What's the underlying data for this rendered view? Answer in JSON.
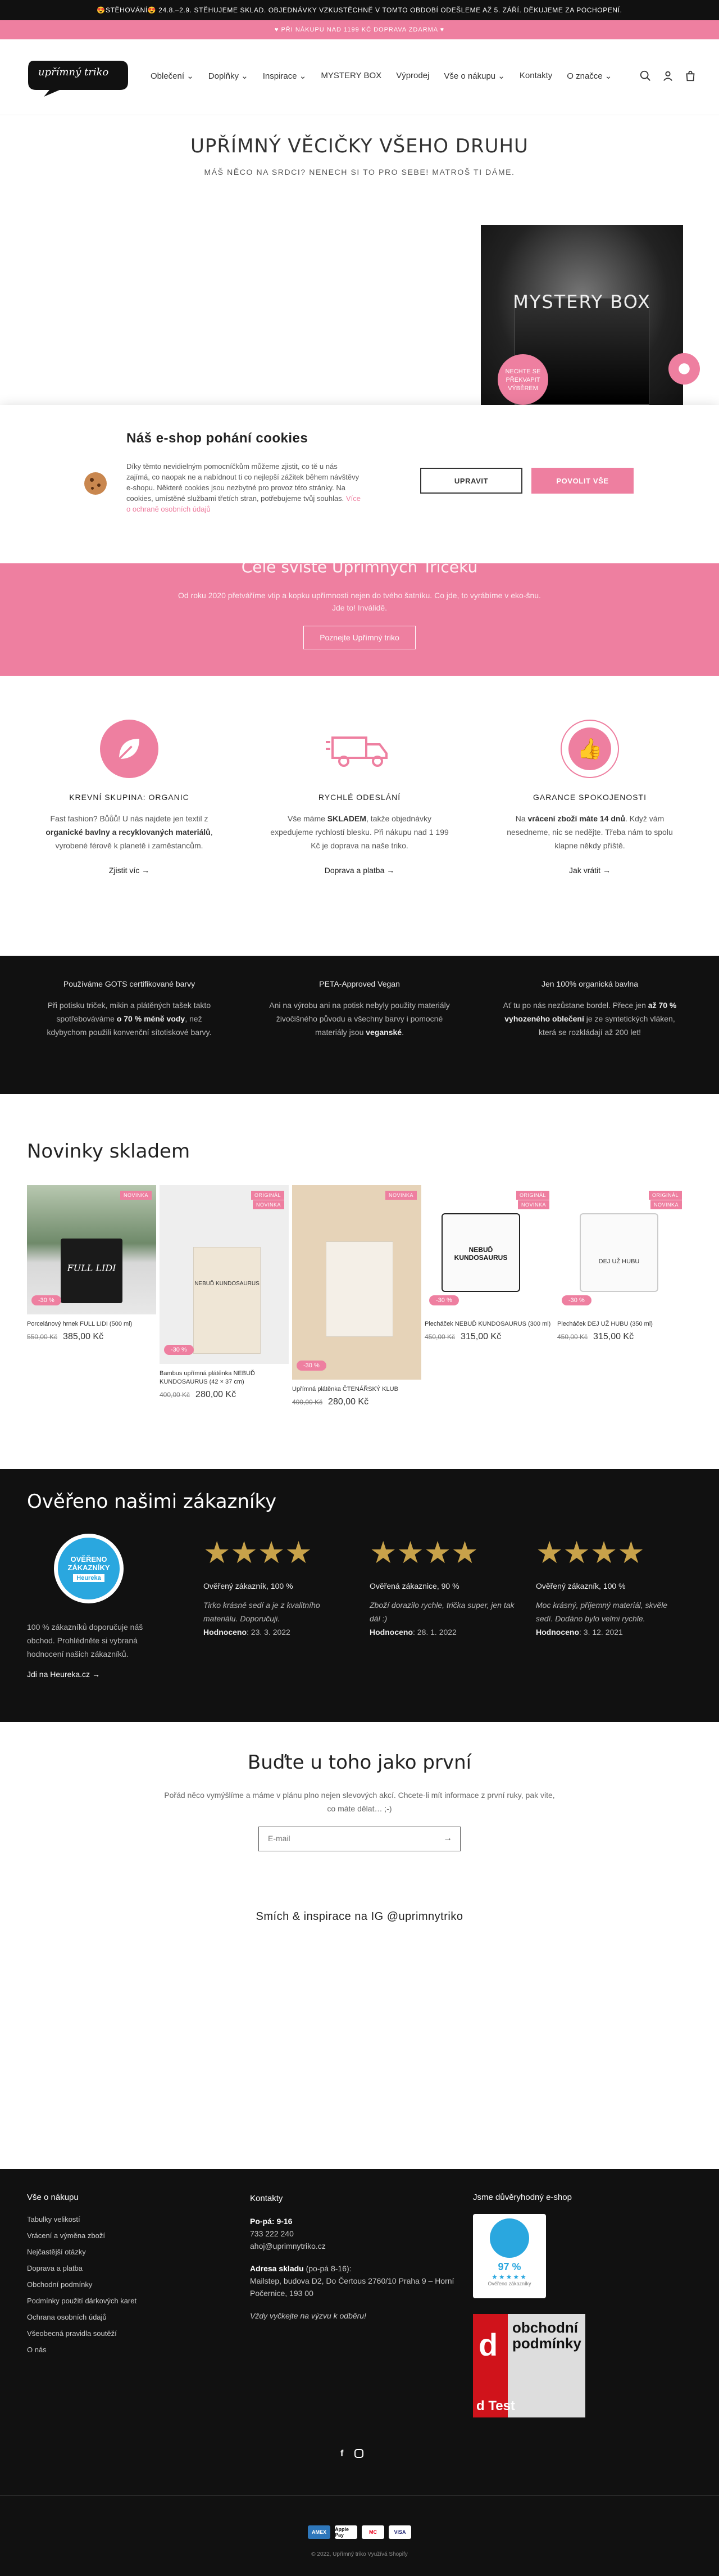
{
  "announcement": {
    "top": "😍STĚHOVÁNÍ😍 24.8.–2.9. STĚHUJEME SKLAD. OBJEDNÁVKY VZKUSTĚCHNĚ V TOMTO OBDOBÍ ODEŠLEME AŽ 5. ZÁŘÍ. DĚKUJEME ZA POCHOPENÍ.",
    "second": "♥ PŘI NÁKUPU NAD 1199 KČ DOPRAVA ZDARMA ♥"
  },
  "logo": {
    "text": "upřímný triko"
  },
  "nav": [
    "Oblečení",
    "Doplňky",
    "Inspirace",
    "MYSTERY BOX",
    "Výprodej",
    "Vše o nákupu",
    "Kontakty",
    "O značce"
  ],
  "header_icons": [
    "search-icon",
    "user-icon",
    "cart-icon"
  ],
  "hero": {
    "title": "UPŘÍMNÝ VĚCIČKY VŠEHO DRUHU",
    "subtitle": "MÁŠ NĚCO NA SRDCI? NENECH SI TO PRO SEBE! MATROŠ TI DÁME.",
    "mystery_label": "MYSTERY BOX",
    "mystery_badge": "NECHTE SE PŘEKVAPIT VÝBĚREM"
  },
  "cookie": {
    "title": "Náš e-shop pohání cookies",
    "text": "Díky těmto nevidielným pomocníčkům můžeme zjistit, co tě u nás zajímá, co naopak ne a nabídnout ti co nejlepší zážitek během návštěvy e-shopu. Některé cookies jsou nezbytné pro provoz této stránky. Na cookies, umístěné službami třetích stran, potřebujeme tvůj souhlas.",
    "link": "Více o ochraně osobních údajů",
    "btn_edit": "UPRAVIT",
    "btn_accept": "POVOLIT VŠE"
  },
  "about_band": {
    "title": "Celé sviště Upřímných Tričeků",
    "text": "Od roku 2020 přetváříme vtip a kopku upřímnosti nejen do tvého šatníku. Co jde, to vyrábíme v eko-šnu.",
    "text2": "Jde to! Inválidě.",
    "button": "Poznejte Upřímný triko"
  },
  "features": [
    {
      "title": "KREVNÍ SKUPINA: ORGANIC",
      "text_a": "Fast fashion? Bůůů! U nás najdete jen textil z ",
      "text_b": "organické bavlny a recyklovaných materiálů",
      "text_c": ", vyrobené férově k planetě i zaměstancům.",
      "link": "Zjistit víc"
    },
    {
      "title": "RYCHLÉ ODESLÁNÍ",
      "text_a": "Vše máme ",
      "text_b": "SKLADEM",
      "text_c": ", takže objednávky expedujeme rychlostí blesku. Při nákupu nad 1 199 Kč je doprava na naše triko.",
      "link": "Doprava a platba"
    },
    {
      "title": "GARANCE SPOKOJENOSTI",
      "text_a": "Na ",
      "text_b": "vrácení zboží máte 14 dnů",
      "text_c": ". Když vám nesedneme, nic se nedějte. Třeba nám to spolu klapne někdy příště.",
      "link": "Jak vrátit"
    }
  ],
  "values": [
    {
      "title": "Používáme GOTS certifikované barvy",
      "text_a": "Při potisku triček, mikin a plátěných tašek takto spotřebováváme ",
      "text_b": "o 70 % méně vody",
      "text_c": ", než kdybychom použili konvenční sítotiskové barvy."
    },
    {
      "title": "PETA-Approved Vegan",
      "text_a": "Ani na výrobu ani na potisk nebyly použity materiály živočišného původu a všechny barvy i pomocné materiály jsou ",
      "text_b": "veganské",
      "text_c": "."
    },
    {
      "title": "Jen 100% organická bavlna",
      "text_a": "Ať tu po nás nezůstane bordel. Přece jen ",
      "text_b": "až 70 % vyhozeného oblečení",
      "text_c": " je ze syntetických vláken, která se rozkládají až 200 let!"
    }
  ],
  "new_section": {
    "title": "Novinky skladem"
  },
  "products": [
    {
      "badge": "NOVINKA",
      "badge2": "",
      "sale": "-30 %",
      "title": "Porcelánový hrnek FULL LIDI (500 ml)",
      "old": "550,00 Kč",
      "price": "385,00 Kč",
      "cup_text": "FULL LIDI"
    },
    {
      "badge": "ORIGINÁL",
      "badge2": "NOVINKA",
      "sale": "-30 %",
      "title": "Bambus upřímná plátěnka NEBUĎ KUNDOSAURUS (42 × 37 cm)",
      "old": "400,00 Kč",
      "price": "280,00 Kč",
      "cup_text": "NEBUĎ KUNDOSAURUS"
    },
    {
      "badge": "NOVINKA",
      "badge2": "",
      "sale": "-30 %",
      "title": "Upřímná plátěnka ČTENÁŘSKÝ KLUB",
      "old": "400,00 Kč",
      "price": "280,00 Kč",
      "cup_text": ""
    },
    {
      "badge": "ORIGINÁL",
      "badge2": "NOVINKA",
      "sale": "-30 %",
      "title": "Plecháček NEBUĎ KUNDOSAURUS (300 ml)",
      "old": "450,00 Kč",
      "price": "315,00 Kč",
      "cup_text": "NEBUĎ KUNDOSAURUS"
    },
    {
      "badge": "ORIGINÁL",
      "badge2": "NOVINKA",
      "sale": "-30 %",
      "title": "Plecháček DEJ UŽ HUBU (350 ml)",
      "old": "450,00 Kč",
      "price": "315,00 Kč",
      "cup_text": "DEJ UŽ HUBU"
    }
  ],
  "reviews": {
    "title": "Ověřeno našimi zákazníky",
    "heureka_badge_top": "OVĚŘENO",
    "heureka_badge_mid": "ZÁKAZNÍKY",
    "heureka_brand": "Heureka",
    "summary": "100 % zákazníků doporučuje náš obchod. Prohlédněte si vybraná hodnocení našich zákazníků.",
    "link": "Jdi na Heureka.cz",
    "items": [
      {
        "head": "Ověřený zákazník, 100 %",
        "text": "Tirko krásně sedí a je z kvalitního materiálu. Doporučuji.",
        "label": "Hodnoceno",
        "date": "23. 3. 2022"
      },
      {
        "head": "Ověřená zákaznice, 90 %",
        "text": "Zboží dorazilo rychle, trička super, jen tak dál :)",
        "label": "Hodnoceno",
        "date": "28. 1. 2022"
      },
      {
        "head": "Ověřený zákazník, 100 %",
        "text": "Moc krásný, příjemný materiál, skvěle sedí. Dodáno bylo velmi rychle.",
        "label": "Hodnoceno",
        "date": "3. 12. 2021"
      }
    ]
  },
  "newsletter": {
    "title": "Buďte u toho jako první",
    "text": "Pořád něco vymýšlíme a máme v plánu plno nejen slevových akcí. Chcete-li mít informace z první ruky, pak vite, co máte dělat… ;-)",
    "placeholder": "E-mail"
  },
  "instagram": {
    "title": "Smích & inspirace na IG @uprimnytriko"
  },
  "footer": {
    "col1_title": "Vše o nákupu",
    "col1": [
      "Tabulky velikostí",
      "Vrácení a výměna zboží",
      "Nejčastější otázky",
      "Doprava a platba",
      "Obchodní podmínky",
      "Podmínky použití dárkových karet",
      "Ochrana osobních údajů",
      "Všeobecná pravidla soutěží",
      "O nás"
    ],
    "col2_title": "Kontakty",
    "hours_label": "Po-pá: 9-16",
    "phone": "733 222 240",
    "email": "ahoj@uprimnytriko.cz",
    "warehouse_label": "Adresa skladu",
    "warehouse_hours": "(po-pá 8-16):",
    "address": "Mailstep, budova D2, Do Čertous 2760/10 Praha 9 – Horní Počernice, 193 00",
    "note": "Vždy vyčkejte na výzvu k odběru!",
    "col3_title": "Jsme důvěryhodný e-shop",
    "heureka_score": "97 %",
    "heureka_caption": "Ověřeno zákazníky",
    "dtest_title": "obchodní podmínky",
    "dtest_brand": "d Test",
    "payments": [
      "AMEX",
      "Apple Pay",
      "MC",
      "VISA"
    ],
    "copyright": "© 2022, Upřímný triko Využívá Shopify"
  },
  "colors": {
    "pink": "#ee7fa0",
    "dark": "#111111"
  }
}
